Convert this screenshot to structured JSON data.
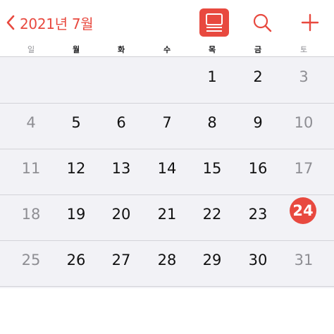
{
  "header": {
    "back_label": "2021년 7월",
    "accent_color": "#e8493f",
    "list_view_icon": "list-view-icon",
    "search_icon": "search-icon",
    "add_icon": "plus-icon"
  },
  "weekdays": [
    "일",
    "월",
    "화",
    "수",
    "목",
    "금",
    "토"
  ],
  "weeks": [
    [
      "",
      "",
      "",
      "",
      "1",
      "2",
      "3"
    ],
    [
      "4",
      "5",
      "6",
      "7",
      "8",
      "9",
      "10"
    ],
    [
      "11",
      "12",
      "13",
      "14",
      "15",
      "16",
      "17"
    ],
    [
      "18",
      "19",
      "20",
      "21",
      "22",
      "23",
      "24"
    ],
    [
      "25",
      "26",
      "27",
      "28",
      "29",
      "30",
      "31"
    ]
  ],
  "today": "24"
}
